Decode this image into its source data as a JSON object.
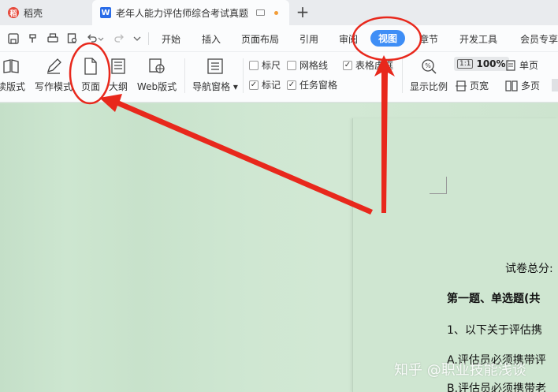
{
  "titlebar": {
    "home_tab": "稻壳",
    "doc_tab": "老年人能力评估师综合考试真题",
    "new_tab_label": "+"
  },
  "menu": {
    "items": [
      "开始",
      "插入",
      "页面布局",
      "引用",
      "审阅",
      "视图",
      "章节",
      "开发工具",
      "会员专享"
    ],
    "active": "视图"
  },
  "ribbon": {
    "read_mode": "读版式",
    "write_mode": "写作模式",
    "page": "页面",
    "outline": "大纲",
    "web_layout": "Web版式",
    "nav_pane": "导航窗格",
    "ruler": {
      "label": "标尺",
      "checked": false
    },
    "gridlines": {
      "label": "网格线",
      "checked": false
    },
    "table_borders": {
      "label": "表格虚框",
      "checked": true
    },
    "marks": {
      "label": "标记",
      "checked": true
    },
    "task_pane": {
      "label": "任务窗格",
      "checked": true
    },
    "show_scale": "显示比例",
    "zoom_icon_text": "1:1",
    "zoom": "100%",
    "page_width": "页宽",
    "single_page": "单页",
    "multi_page": "多页"
  },
  "document": {
    "line1": "试卷总分:",
    "line2": "第一题、单选题(共",
    "line3": "1、以下关于评估携",
    "line4": "A.评估员必须携带评",
    "line5": "B.评估员必须携带老"
  },
  "watermark": "知乎 @职业技能浅谈",
  "colors": {
    "accent": "#3e8ef6",
    "annotation": "#e8281c",
    "doc_background": "#cfe6d1"
  }
}
